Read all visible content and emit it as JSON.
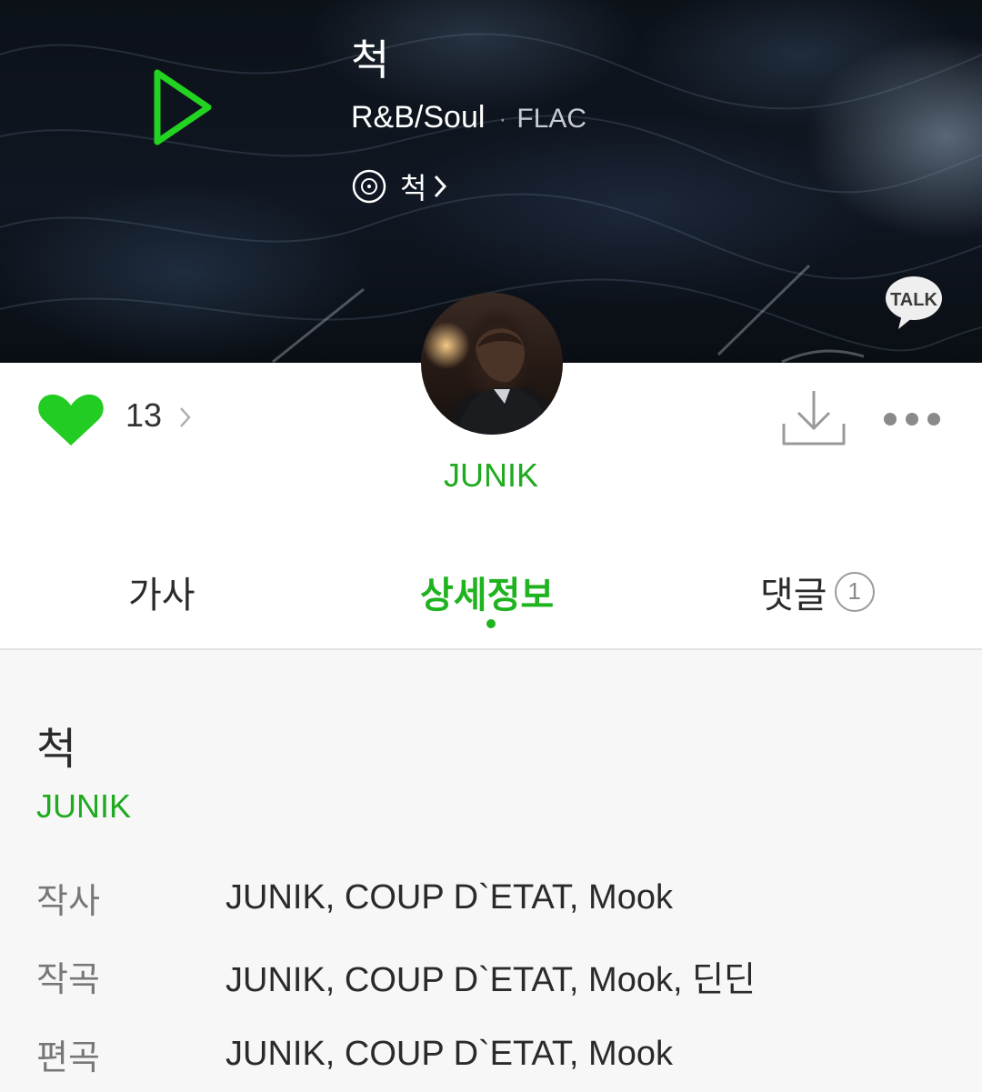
{
  "hero": {
    "song_title": "척",
    "genre": "R&B/Soul",
    "separator": "·",
    "format": "FLAC",
    "album_name": "척",
    "talk_label": "TALK"
  },
  "actions": {
    "like_count": "13"
  },
  "artist": {
    "name": "JUNIK"
  },
  "tabs": [
    {
      "label": "가사"
    },
    {
      "label": "상세정보"
    },
    {
      "label": "댓글",
      "badge": "1"
    }
  ],
  "details": {
    "title": "척",
    "artist": "JUNIK",
    "credits": [
      {
        "label": "작사",
        "value": "JUNIK, COUP D`ETAT, Mook"
      },
      {
        "label": "작곡",
        "value": "JUNIK, COUP D`ETAT, Mook, 딘딘"
      },
      {
        "label": "편곡",
        "value": "JUNIK, COUP D`ETAT, Mook"
      }
    ]
  },
  "colors": {
    "accent_green": "#1fb31f",
    "hero_bg": "#0c1118",
    "body_bg": "#f7f7f7"
  },
  "icons": [
    "play-icon",
    "album-disc-icon",
    "chevron-right-icon",
    "talk-bubble-icon",
    "heart-icon",
    "download-icon",
    "more-dots-icon"
  ]
}
